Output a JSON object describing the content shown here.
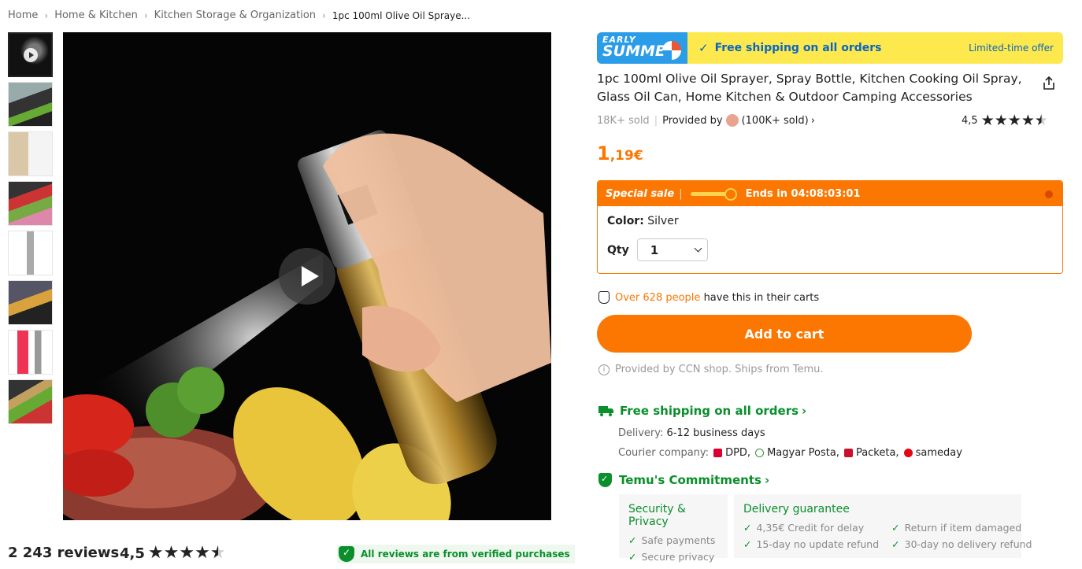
{
  "breadcrumb": [
    "Home",
    "Home & Kitchen",
    "Kitchen Storage & Organization",
    "1pc 100ml Olive Oil Spraye..."
  ],
  "promo": {
    "badge_line1": "EARLY",
    "badge_line2": "SUMMER",
    "shipping": "Free shipping on all orders",
    "limited": "Limited-time offer"
  },
  "product": {
    "title": "1pc 100ml Olive Oil Sprayer, Spray Bottle, Kitchen Cooking Oil Spray, Glass Oil Can, Home Kitchen & Outdoor Camping Accessories",
    "sold": "18K+ sold",
    "provided_by": "Provided by",
    "provider_sold": "(100K+ sold)",
    "rating": "4,5",
    "price_main": "1",
    "price_rest": ",19€"
  },
  "sale": {
    "label": "Special sale",
    "ends": "Ends in 04:08:03:01",
    "color_label": "Color:",
    "color_value": "Silver",
    "qty_label": "Qty",
    "qty_value": "1"
  },
  "carts": {
    "highlight": "Over 628 people",
    "rest": "have this in their carts"
  },
  "add_to_cart": "Add to cart",
  "provided_note": "Provided by CCN shop. Ships from Temu.",
  "shipping": {
    "title": "Free shipping on all orders",
    "delivery_label": "Delivery:",
    "delivery_value": "6-12 business days",
    "courier_label": "Courier company:",
    "couriers": [
      "DPD,",
      "Magyar Posta,",
      "Packeta,",
      "sameday"
    ]
  },
  "commitments": {
    "title": "Temu's Commitments",
    "security_title": "Security & Privacy",
    "security_items": [
      "Safe payments",
      "Secure privacy"
    ],
    "delivery_title": "Delivery guarantee",
    "delivery_items_col1": [
      "4,35€ Credit for delay",
      "15-day no update refund"
    ],
    "delivery_items_col2": [
      "Return if item damaged",
      "30-day no delivery refund"
    ]
  },
  "reviews": {
    "count": "2 243 reviews",
    "rating": "4,5",
    "verified": "All reviews are from verified purchases"
  },
  "colors": {
    "accent": "#fb7701",
    "green": "#0a8f2c",
    "promo_yellow": "#fde84e",
    "promo_blue": "#0a66c2"
  },
  "icons": [
    "play-icon",
    "share-icon",
    "star-icon",
    "bag-icon",
    "info-icon",
    "truck-icon",
    "shield-icon",
    "check-icon",
    "chevron-down-icon"
  ]
}
